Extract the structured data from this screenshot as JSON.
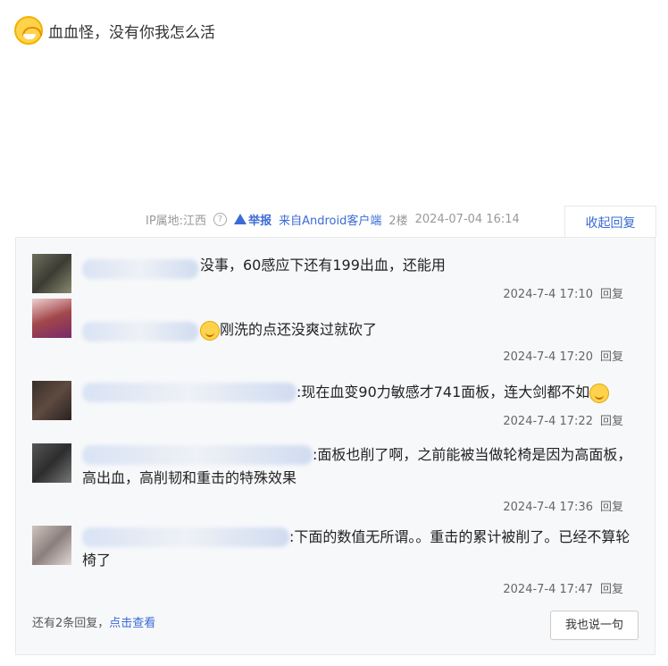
{
  "post": {
    "emoji": "crying-emoji",
    "text": "血血怪，没有你我怎么活"
  },
  "meta": {
    "ip": "IP属地:江西",
    "report": "举报",
    "source": "来自Android客户端",
    "floor": "2楼",
    "datetime": "2024-07-04 16:14",
    "collapse": "收起回复"
  },
  "comments": [
    {
      "text": "没事，60感应下还有199出血，还能用",
      "time": "2024-7-4 17:10",
      "reply": "回复"
    },
    {
      "text": "刚洗的点还没爽过就砍了",
      "time": "2024-7-4 17:20",
      "reply": "回复"
    },
    {
      "text": ":现在血变90力敏感才741面板，连大剑都不如",
      "time": "2024-7-4 17:22",
      "reply": "回复"
    },
    {
      "text": ":面板也削了啊，之前能被当做轮椅是因为高面板，高出血，高削韧和重击的特殊效果",
      "time": "2024-7-4 17:36",
      "reply": "回复"
    },
    {
      "text": ":下面的数值无所谓。。重击的累计被削了。已经不算轮椅了",
      "time": "2024-7-4 17:47",
      "reply": "回复"
    }
  ],
  "footer": {
    "more": "还有2条回复，",
    "view": "点击查看",
    "say": "我也说一句"
  }
}
